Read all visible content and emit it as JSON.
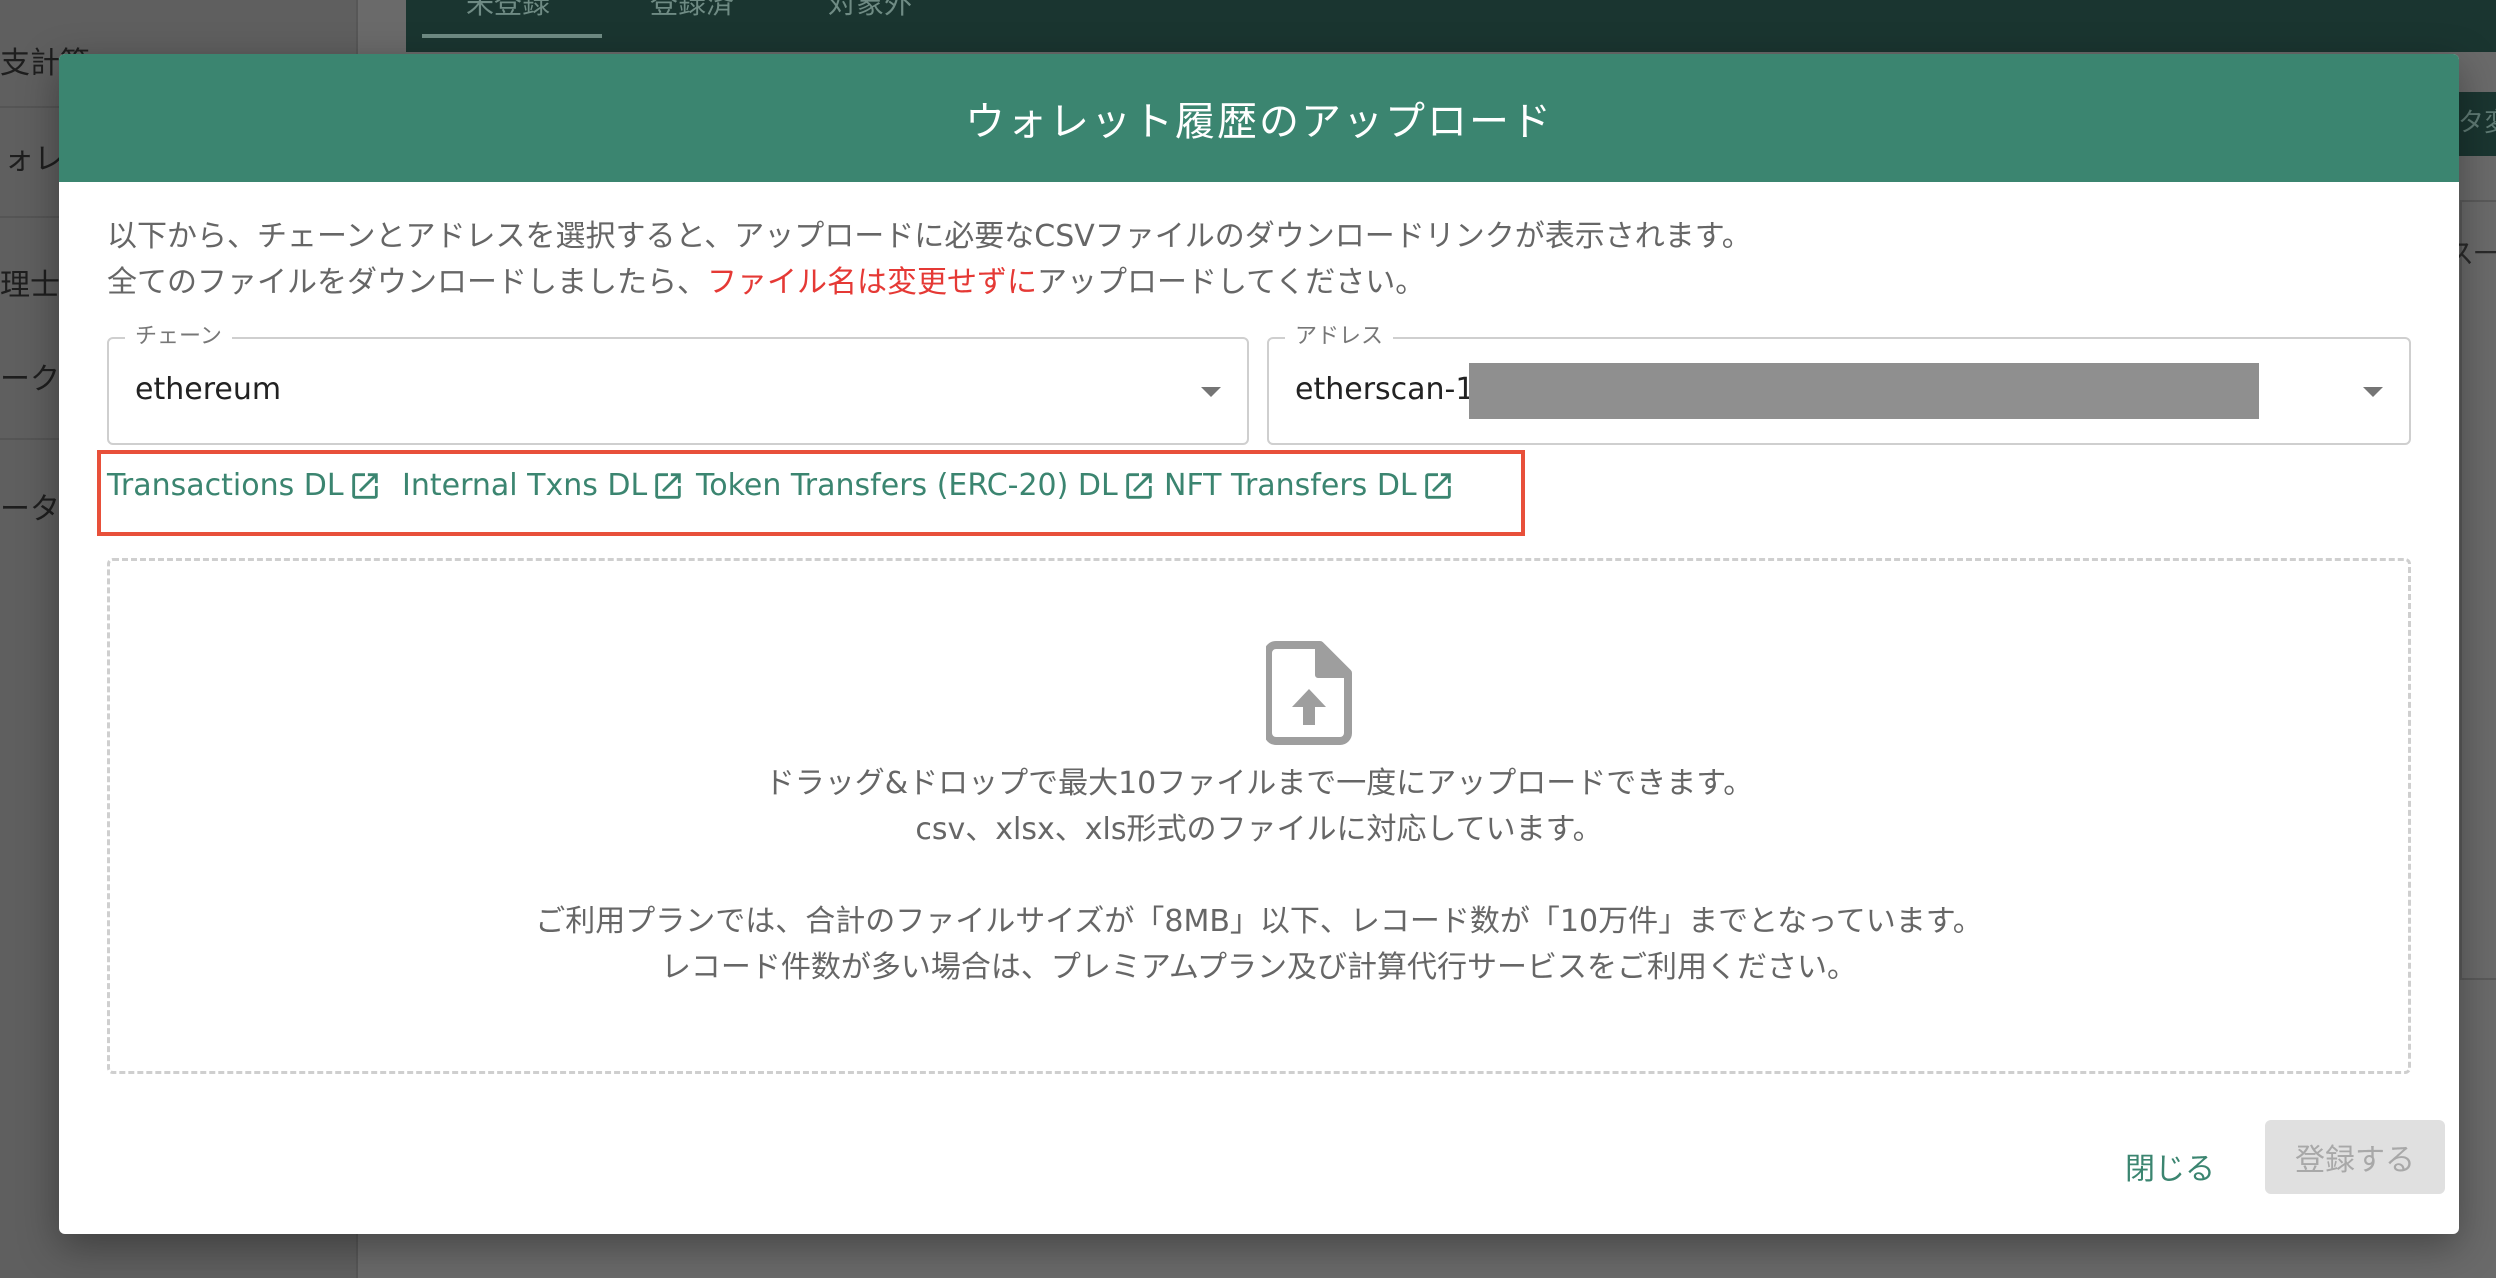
{
  "background": {
    "sidebar_items": [
      "支計算",
      "ォレ",
      "理士",
      "ーク",
      "ータ"
    ],
    "tabs": [
      "未登録",
      "登録済",
      "対象外"
    ],
    "right_button": "タ変",
    "right_text": "ス一"
  },
  "modal": {
    "title": "ウォレット履歴のアップロード",
    "description_line1": "以下から、チェーンとアドレスを選択すると、アップロードに必要なCSVファイルのダウンロードリンクが表示されます。",
    "description_line2_before": "全てのファイルをダウンロードしましたら、",
    "description_line2_warning": "ファイル名は変更せずに",
    "description_line2_after": "アップロードしてください。",
    "chain": {
      "label": "チェーン",
      "value": "ethereum"
    },
    "address": {
      "label": "アドレス",
      "value": "etherscan-1"
    },
    "links": [
      "Transactions DL",
      "Internal Txns DL",
      "Token Transfers (ERC-20) DL",
      "NFT Transfers DL"
    ],
    "dropzone": {
      "icon": "file-upload-icon",
      "line1": "ドラッグ&ドロップで最大10ファイルまで一度にアップロードできます。",
      "line2": "csv、xlsx、xls形式のファイルに対応しています。",
      "line3": "ご利用プランでは、合計のファイルサイズが「8MB」以下、レコード数が「10万件」までとなっています。",
      "line4": "レコード件数が多い場合は、プレミアムプラン及び計算代行サービスをご利用ください。"
    },
    "close_label": "閉じる",
    "submit_label": "登録する"
  },
  "colors": {
    "accent": "#3b8570",
    "warning": "#e53935",
    "highlight_box": "#e8503a"
  }
}
